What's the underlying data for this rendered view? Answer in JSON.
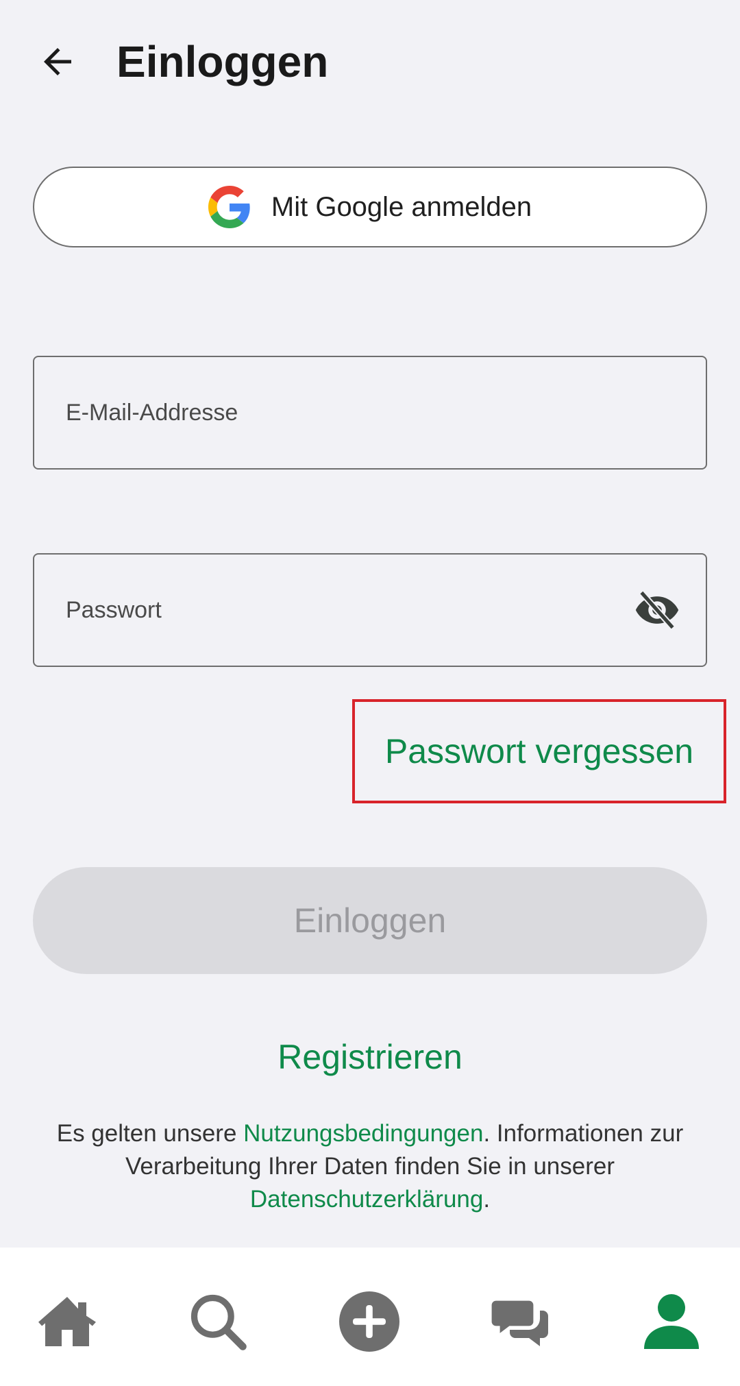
{
  "header": {
    "title": "Einloggen",
    "back_icon": "arrow-left-icon"
  },
  "google": {
    "label": "Mit Google anmelden",
    "icon": "google-icon"
  },
  "email": {
    "placeholder": "E-Mail-Addresse",
    "value": ""
  },
  "password": {
    "placeholder": "Passwort",
    "value": "",
    "visibility_icon": "eye-off-icon"
  },
  "forgot": {
    "label": "Passwort vergessen"
  },
  "login": {
    "label": "Einloggen",
    "enabled": false
  },
  "register": {
    "label": "Registrieren"
  },
  "legal": {
    "part1": "Es gelten unsere ",
    "terms_link": "Nutzungsbedingungen",
    "part2": ". Informationen zur Verarbeitung Ihrer Daten finden Sie in unserer ",
    "privacy_link": "Datenschutzerklärung",
    "part3": "."
  },
  "nav": {
    "items": [
      {
        "icon": "home-icon"
      },
      {
        "icon": "search-icon"
      },
      {
        "icon": "add-icon"
      },
      {
        "icon": "chat-icon"
      },
      {
        "icon": "profile-icon",
        "active": true
      }
    ]
  },
  "colors": {
    "accent": "#0f8a4a",
    "background": "#f2f2f6",
    "disabled_button": "#dadade",
    "highlight_box": "#d8232a",
    "nav_inactive": "#6e6e6e"
  }
}
